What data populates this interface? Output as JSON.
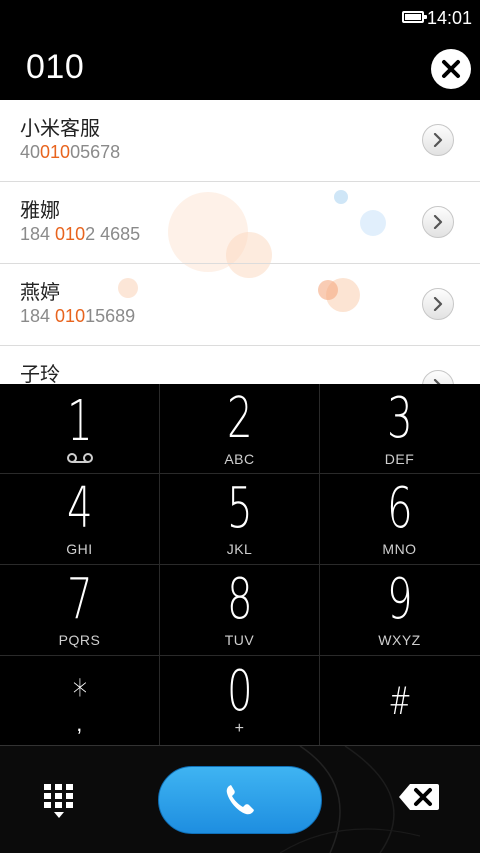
{
  "status_bar": {
    "time": "14:01"
  },
  "dialer": {
    "number": "010"
  },
  "contacts": [
    {
      "name": "小米客服",
      "number_pre": "40",
      "number_match": "010",
      "number_post": "05678"
    },
    {
      "name": "雅娜",
      "number_pre": "184 ",
      "number_match": "010",
      "number_post": "2 4685"
    },
    {
      "name": "燕婷",
      "number_pre": "184 ",
      "number_match": "010",
      "number_post": "15689"
    },
    {
      "name": "子玲",
      "number_pre": "",
      "number_match": "",
      "number_post": ""
    }
  ],
  "keypad": [
    {
      "digit": "1",
      "letters": ""
    },
    {
      "digit": "2",
      "letters": "ABC"
    },
    {
      "digit": "3",
      "letters": "DEF"
    },
    {
      "digit": "4",
      "letters": "GHI"
    },
    {
      "digit": "5",
      "letters": "JKL"
    },
    {
      "digit": "6",
      "letters": "MNO"
    },
    {
      "digit": "7",
      "letters": "PQRS"
    },
    {
      "digit": "8",
      "letters": "TUV"
    },
    {
      "digit": "9",
      "letters": "WXYZ"
    },
    {
      "digit": "*",
      "letters": ","
    },
    {
      "digit": "0",
      "letters": "+"
    },
    {
      "digit": "#",
      "letters": ""
    }
  ],
  "colors": {
    "match_highlight": "#e8641e",
    "call_button": "#2aa2ea"
  },
  "icons": {
    "clear": "close-icon",
    "detail": "chevron-right-icon",
    "voicemail": "voicemail-icon",
    "keypad_toggle": "dialpad-icon",
    "call": "phone-icon",
    "backspace": "backspace-icon"
  }
}
